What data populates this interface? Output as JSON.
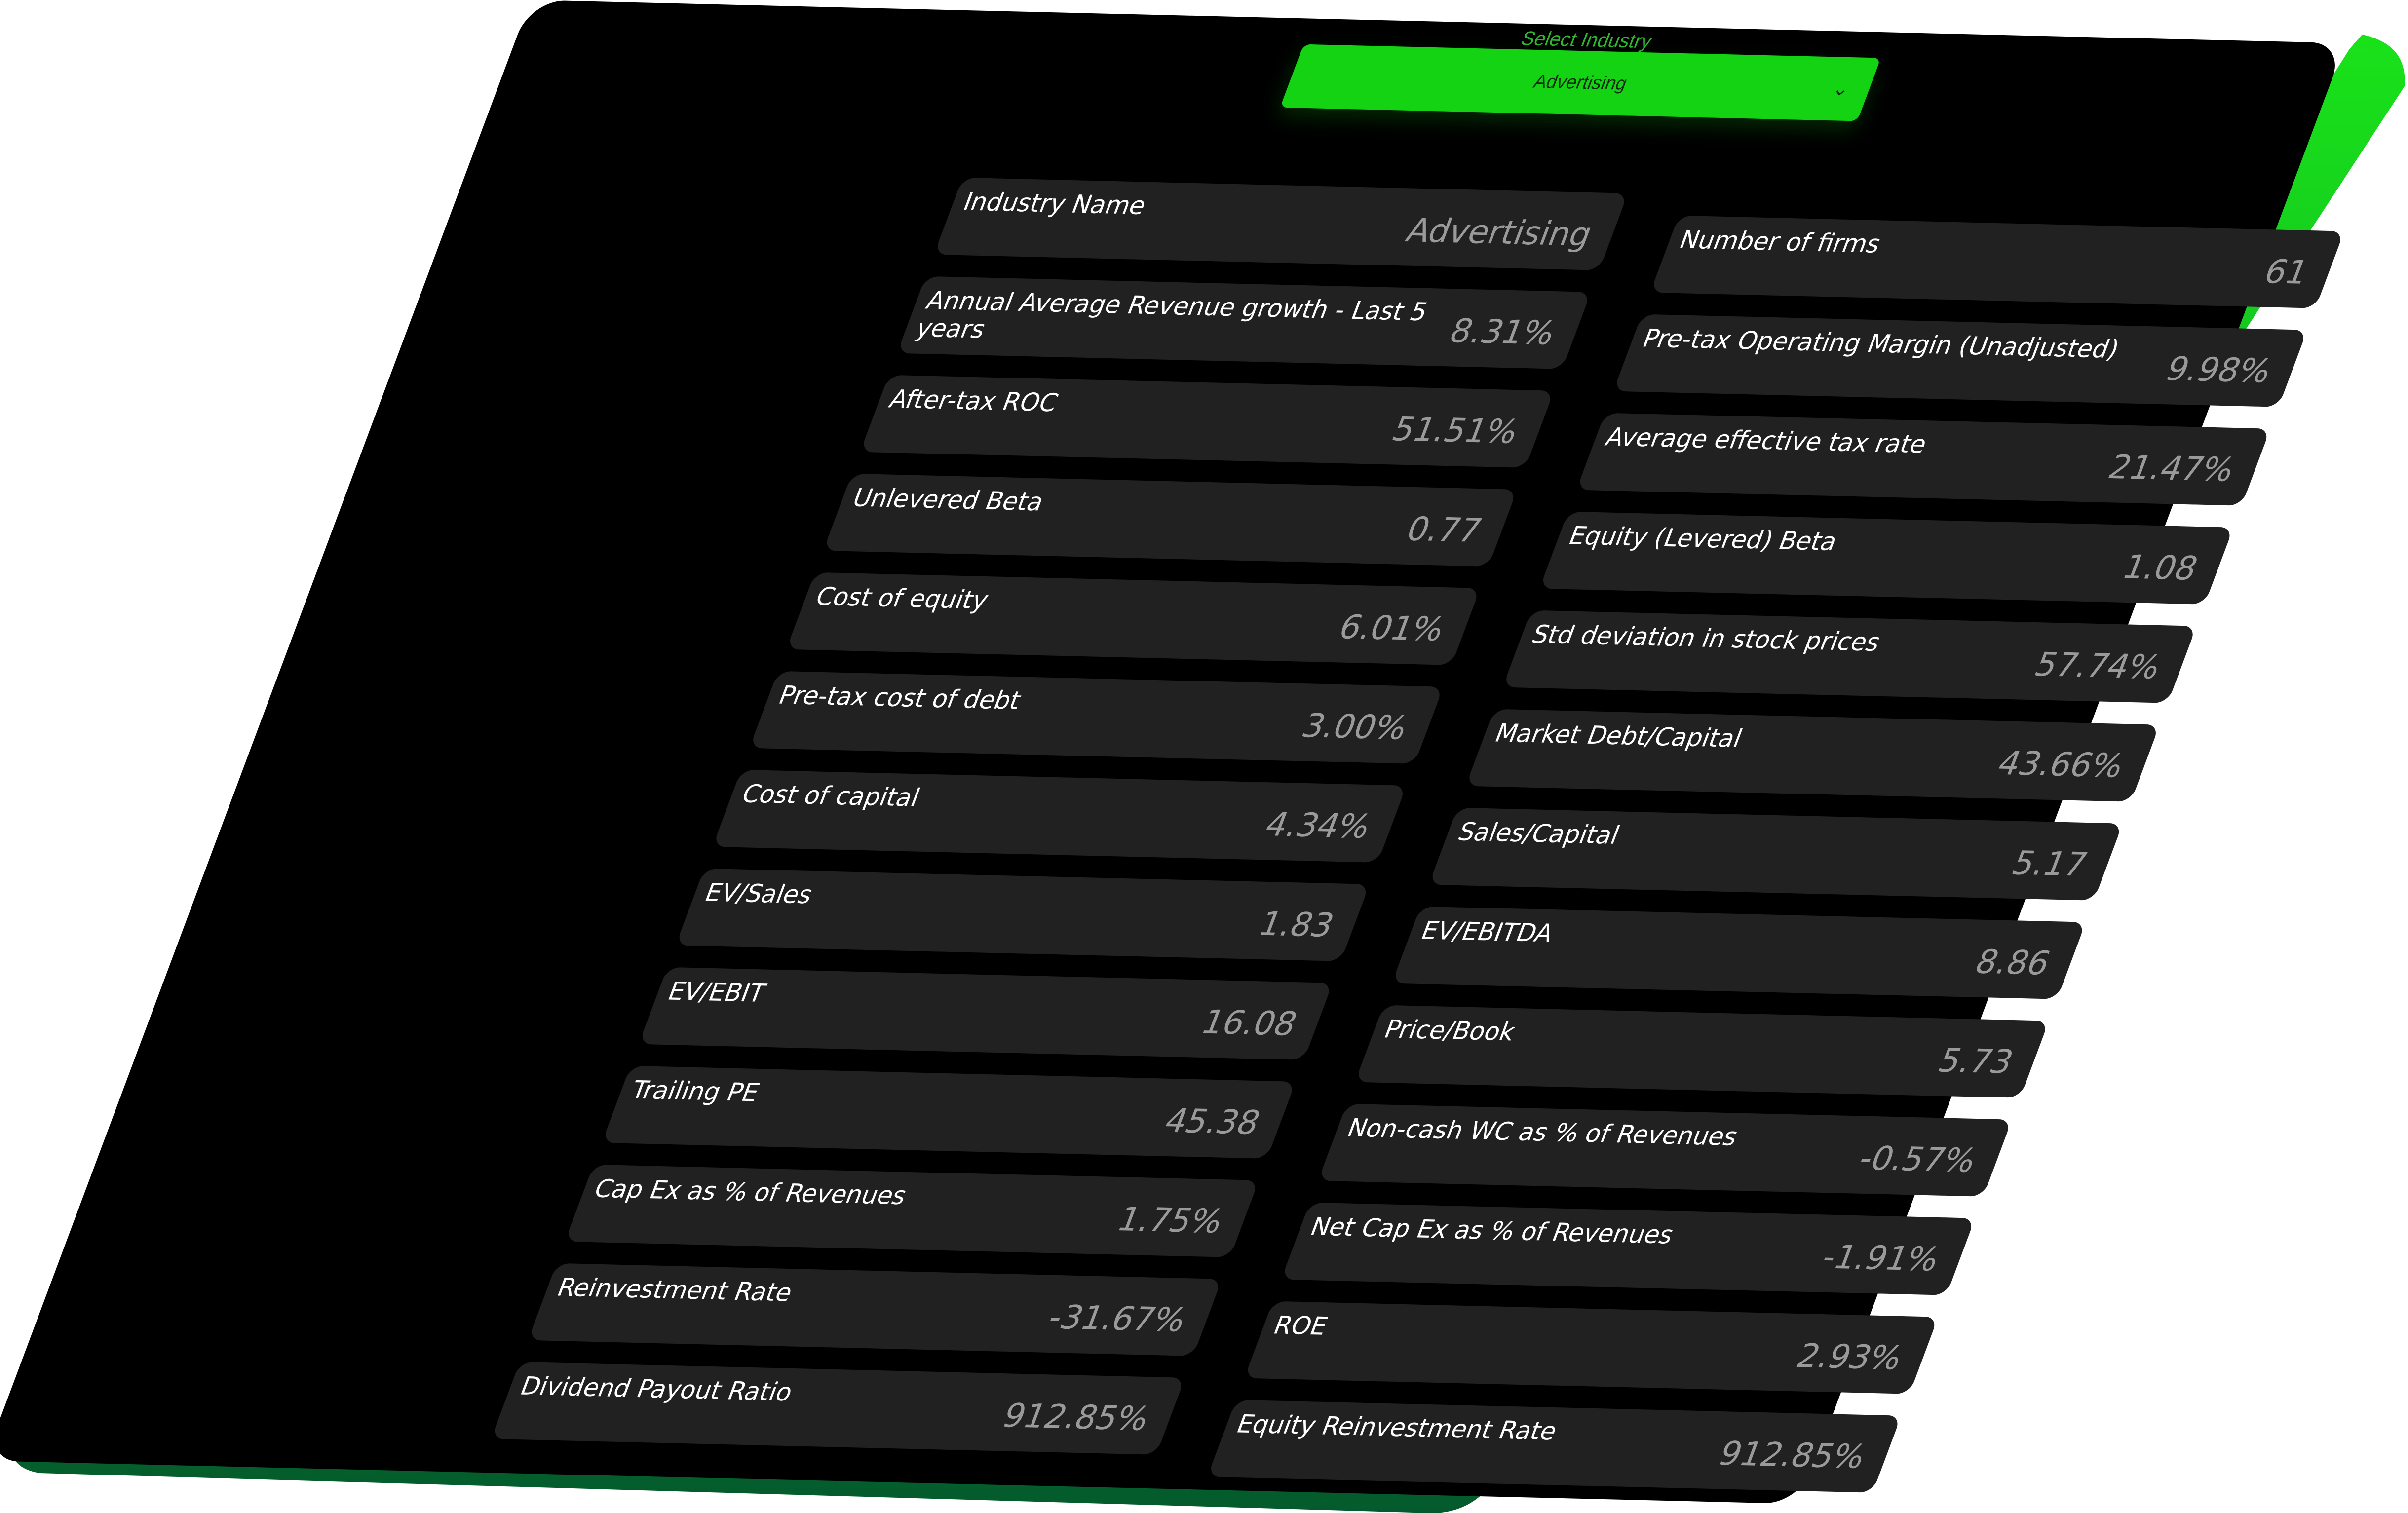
{
  "dropdown": {
    "label": "Select Industry",
    "value": "Advertising",
    "chevron_icon": "chevron-down-icon"
  },
  "colors": {
    "accent": "#13d313",
    "panel": "#000000",
    "card": "#212121",
    "edge_top": "#19e219",
    "edge_bottom": "#045a2c"
  },
  "metrics": [
    {
      "label": "Industry Name",
      "value": "Advertising"
    },
    {
      "label": "Number of firms",
      "value": "61"
    },
    {
      "label": "Annual Average Revenue growth - Last 5 years",
      "value": "8.31%"
    },
    {
      "label": "Pre-tax Operating Margin (Unadjusted)",
      "value": "9.98%"
    },
    {
      "label": "After-tax ROC",
      "value": "51.51%"
    },
    {
      "label": "Average effective tax rate",
      "value": "21.47%"
    },
    {
      "label": "Unlevered Beta",
      "value": "0.77"
    },
    {
      "label": "Equity (Levered) Beta",
      "value": "1.08"
    },
    {
      "label": "Cost of equity",
      "value": "6.01%"
    },
    {
      "label": "Std deviation in stock prices",
      "value": "57.74%"
    },
    {
      "label": "Pre-tax cost of debt",
      "value": "3.00%"
    },
    {
      "label": "Market Debt/Capital",
      "value": "43.66%"
    },
    {
      "label": "Cost of capital",
      "value": "4.34%"
    },
    {
      "label": "Sales/Capital",
      "value": "5.17"
    },
    {
      "label": "EV/Sales",
      "value": "1.83"
    },
    {
      "label": "EV/EBITDA",
      "value": "8.86"
    },
    {
      "label": "EV/EBIT",
      "value": "16.08"
    },
    {
      "label": "Price/Book",
      "value": "5.73"
    },
    {
      "label": "Trailing PE",
      "value": "45.38"
    },
    {
      "label": "Non-cash WC as % of Revenues",
      "value": "-0.57%"
    },
    {
      "label": "Cap Ex as % of Revenues",
      "value": "1.75%"
    },
    {
      "label": "Net Cap Ex as % of Revenues",
      "value": "-1.91%"
    },
    {
      "label": "Reinvestment Rate",
      "value": "-31.67%"
    },
    {
      "label": "ROE",
      "value": "2.93%"
    },
    {
      "label": "Dividend Payout Ratio",
      "value": "912.85%"
    },
    {
      "label": "Equity Reinvestment Rate",
      "value": "912.85%"
    }
  ]
}
